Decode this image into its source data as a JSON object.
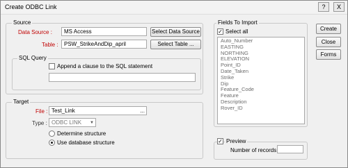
{
  "window": {
    "title": "Create ODBC Link",
    "help_label": "?",
    "close_label": "X"
  },
  "source": {
    "group_label": "Source",
    "data_source_label": "Data Source :",
    "data_source_value": "MS Access",
    "select_data_source_label": "Select Data Source ...",
    "table_label": "Table :",
    "table_value": "PSW_StrikeAndDip_april",
    "select_table_label": "Select  Table ..."
  },
  "sql_query": {
    "group_label": "SQL Query",
    "append_label": "Append a clause to the SQL statement",
    "append_checked": false,
    "clause_value": ""
  },
  "target": {
    "group_label": "Target",
    "file_label": "File :",
    "file_value": "Test_Link",
    "file_ellipsis": "...",
    "type_label": "Type :",
    "type_value": "ODBC LINK",
    "determine_structure_label": "Determine structure",
    "use_database_structure_label": "Use database structure",
    "selected_structure": "Use database structure"
  },
  "fields": {
    "group_label": "Fields To Import",
    "select_all_label": "Select all",
    "select_all_checked": true,
    "items": [
      "Auto_Number",
      "EASTING",
      "NORTHING",
      "ELEVATION",
      "Point_ID",
      "Date_Taken",
      "Strike",
      "Dip",
      "Feature_Code",
      "Feature",
      "Description",
      "Rover_ID"
    ]
  },
  "preview": {
    "label": "Preview",
    "checked": true,
    "records_label": "Number of records :",
    "records_value": ""
  },
  "actions": {
    "create_label": "Create",
    "close_label": "Close",
    "forms_label": "Forms"
  }
}
